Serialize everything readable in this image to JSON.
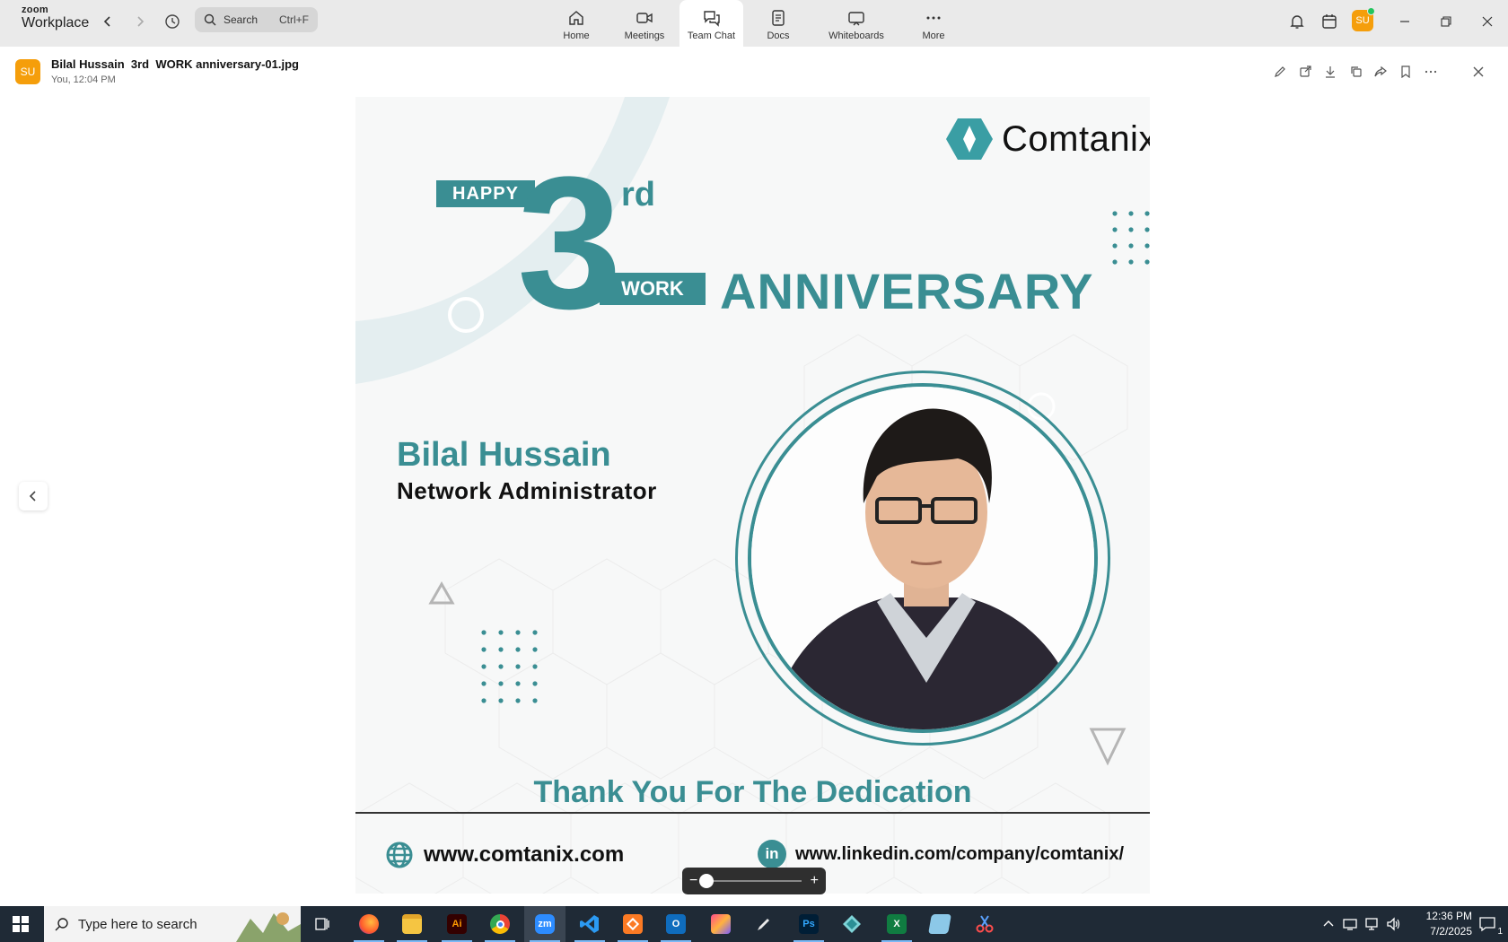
{
  "app": {
    "logo_top": "zoom",
    "logo_bottom": "Workplace",
    "search_placeholder": "Search",
    "search_shortcut": "Ctrl+F",
    "user_initials": "SU"
  },
  "nav_tabs": [
    {
      "label": "Home",
      "icon": "home-icon"
    },
    {
      "label": "Meetings",
      "icon": "video-icon"
    },
    {
      "label": "Team Chat",
      "icon": "chat-icon"
    },
    {
      "label": "Docs",
      "icon": "doc-icon"
    },
    {
      "label": "Whiteboards",
      "icon": "whiteboard-icon"
    },
    {
      "label": "More",
      "icon": "more-icon"
    }
  ],
  "active_tab": "Team Chat",
  "viewer": {
    "sender_initials": "SU",
    "file_name": "Bilal Hussain  3rd  WORK anniversary-01.jpg",
    "meta": "You, 12:04 PM",
    "tools": [
      "edit-icon",
      "open-external-icon",
      "download-icon",
      "copy-icon",
      "share-icon",
      "bookmark-icon",
      "more-icon",
      "close-icon"
    ]
  },
  "image": {
    "brand": "Comtanix",
    "happy": "HAPPY",
    "number": "3",
    "suffix": "rd",
    "work": "WORK",
    "anniversary": "ANNIVERSARY",
    "employee_name": "Bilal Hussain",
    "employee_role": "Network Administrator",
    "thanks": "Thank You For The Dedication",
    "website": "www.comtanix.com",
    "linkedin": "www.linkedin.com/company/comtanix/",
    "linkedin_badge": "in"
  },
  "zoom": {
    "minus": "−",
    "plus": "+",
    "level": 0.0
  },
  "taskbar": {
    "search_placeholder": "Type here to search",
    "apps": [
      {
        "name": "task-view",
        "label": ""
      },
      {
        "name": "firefox",
        "label": ""
      },
      {
        "name": "file-explorer",
        "label": ""
      },
      {
        "name": "illustrator",
        "label": "Ai"
      },
      {
        "name": "chrome",
        "label": ""
      },
      {
        "name": "zoom",
        "label": "zm"
      },
      {
        "name": "vscode",
        "label": ""
      },
      {
        "name": "xampp",
        "label": ""
      },
      {
        "name": "outlook",
        "label": ""
      },
      {
        "name": "creative-cloud",
        "label": ""
      },
      {
        "name": "pen-tool",
        "label": ""
      },
      {
        "name": "photoshop",
        "label": "Ps"
      },
      {
        "name": "app-diamond",
        "label": ""
      },
      {
        "name": "excel",
        "label": "X"
      },
      {
        "name": "notepad",
        "label": ""
      },
      {
        "name": "snipping",
        "label": ""
      }
    ],
    "time": "12:36 PM",
    "date": "7/2/2025",
    "notification_count": "1"
  },
  "colors": {
    "brand_teal": "#3a8e93",
    "titlebar": "#eaeaea",
    "taskbar": "#1f2a36",
    "avatar": "#f59e0b"
  }
}
